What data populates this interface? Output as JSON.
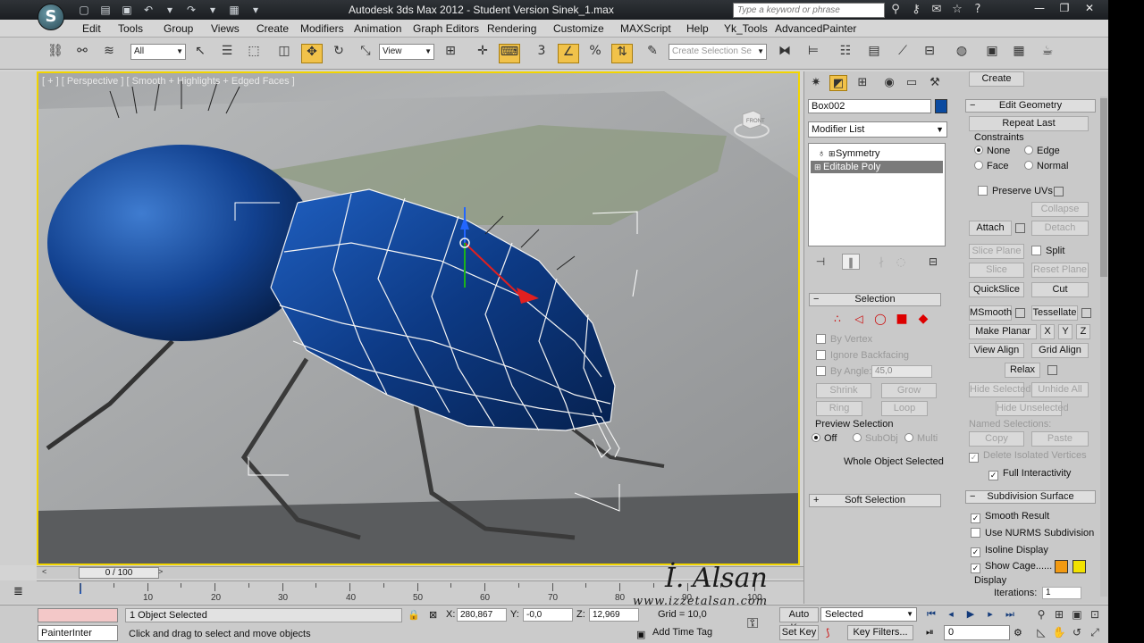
{
  "window": {
    "title": "Autodesk 3ds Max  2012  - Student Version    Sinek_1.max",
    "logo_glyph": "S",
    "search_placeholder": "Type a keyword or phrase"
  },
  "menu": [
    "Edit",
    "Tools",
    "Group",
    "Views",
    "Create",
    "Modifiers",
    "Animation",
    "Graph Editors",
    "Rendering",
    "Customize",
    "MAXScript",
    "Help",
    "Yk_Tools",
    "AdvancedPainter"
  ],
  "toolbar": {
    "filter_value": "All",
    "ref_coord_value": "View",
    "selection_set_placeholder": "Create Selection Se"
  },
  "viewport": {
    "label": "[ + ] [ Perspective ] [ Smooth + Highlights + Edged Faces ]",
    "viewcube_label": "FRONT"
  },
  "time_slider": {
    "current": "0 / 100"
  },
  "trackbar": {
    "ticks": [
      "10",
      "20",
      "30",
      "40",
      "50",
      "60",
      "70",
      "80",
      "90",
      "100"
    ]
  },
  "status": {
    "maxscript": "PainterInter",
    "selection": "1 Object Selected",
    "prompt": "Click and drag to select and move objects",
    "x_label": "X:",
    "x_value": "280,867",
    "y_label": "Y:",
    "y_value": "-0,0",
    "z_label": "Z:",
    "z_value": "12,969",
    "grid": "Grid = 10,0",
    "add_time_tag": "Add Time Tag",
    "auto_key": "Auto Key",
    "set_key": "Set Key",
    "selected_combo": "Selected",
    "key_filters": "Key Filters...",
    "frame": "0"
  },
  "command_panel": {
    "object_name": "Box002",
    "object_color": "#0a4aa0",
    "modifier_list": "Modifier List",
    "stack": [
      {
        "name": "Symmetry",
        "selected": false
      },
      {
        "name": "Editable Poly",
        "selected": true
      }
    ],
    "selection": {
      "title": "Selection",
      "by_vertex": "By Vertex",
      "ignore_backfacing": "Ignore Backfacing",
      "by_angle": "By Angle:",
      "angle_value": "45,0",
      "shrink": "Shrink",
      "grow": "Grow",
      "ring": "Ring",
      "loop": "Loop",
      "preview_selection": "Preview Selection",
      "off": "Off",
      "subobj": "SubObj",
      "multi": "Multi",
      "whole": "Whole Object Selected"
    },
    "soft_selection": {
      "title": "Soft Selection"
    },
    "edit_geometry": {
      "title": "Edit Geometry",
      "repeat_last": "Repeat Last",
      "constraints": "Constraints",
      "none": "None",
      "edge": "Edge",
      "face": "Face",
      "normal": "Normal",
      "preserve_uvs": "Preserve UVs",
      "create": "Create",
      "collapse": "Collapse",
      "attach": "Attach",
      "detach": "Detach",
      "slice_plane": "Slice Plane",
      "split": "Split",
      "slice": "Slice",
      "reset_plane": "Reset Plane",
      "quickslice": "QuickSlice",
      "cut": "Cut",
      "msmooth": "MSmooth",
      "tessellate": "Tessellate",
      "make_planar": "Make Planar",
      "x": "X",
      "y": "Y",
      "z": "Z",
      "view_align": "View Align",
      "grid_align": "Grid Align",
      "relax": "Relax",
      "hide_selected": "Hide Selected",
      "unhide_all": "Unhide All",
      "hide_unselected": "Hide Unselected",
      "named_selections": "Named Selections:",
      "copy": "Copy",
      "paste": "Paste",
      "delete_isolated": "Delete Isolated Vertices",
      "full_interactivity": "Full Interactivity"
    },
    "subdivision_surface": {
      "title": "Subdivision Surface",
      "smooth_result": "Smooth Result",
      "use_nurms": "Use NURMS Subdivision",
      "isoline_display": "Isoline Display",
      "show_cage": "Show Cage......",
      "cage_color_1": "#f29a12",
      "cage_color_2": "#f2e200",
      "display": "Display",
      "iterations_label": "Iterations:",
      "iterations_value": "1"
    }
  },
  "watermark": {
    "signature": "İ. Alsan",
    "url": "www.izzetalsan.com"
  }
}
